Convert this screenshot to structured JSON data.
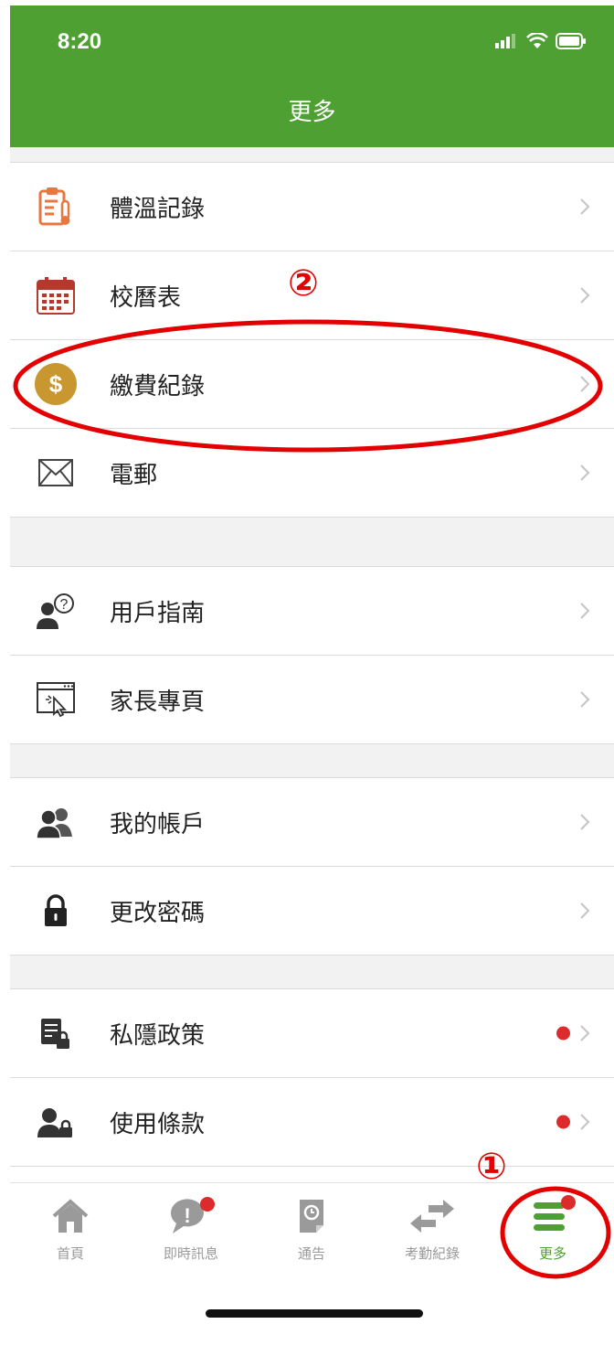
{
  "status": {
    "time": "8:20"
  },
  "header": {
    "title": "更多"
  },
  "menu": [
    {
      "label": "體溫記錄",
      "icon": "thermometer-clipboard-icon"
    },
    {
      "label": "校曆表",
      "icon": "calendar-icon"
    },
    {
      "label": "繳費紀錄",
      "icon": "dollar-coin-icon"
    },
    {
      "label": "電郵",
      "icon": "envelope-icon"
    },
    {
      "label": "用戶指南",
      "icon": "user-question-icon"
    },
    {
      "label": "家長專頁",
      "icon": "web-cursor-icon"
    },
    {
      "label": "我的帳戶",
      "icon": "users-icon"
    },
    {
      "label": "更改密碼",
      "icon": "lock-icon"
    },
    {
      "label": "私隱政策",
      "icon": "document-lock-icon"
    },
    {
      "label": "使用條款",
      "icon": "user-lock-icon"
    }
  ],
  "tabs": [
    {
      "label": "首頁",
      "icon": "home-icon"
    },
    {
      "label": "即時訊息",
      "icon": "message-icon"
    },
    {
      "label": "通告",
      "icon": "notice-icon"
    },
    {
      "label": "考勤紀錄",
      "icon": "swap-arrows-icon"
    },
    {
      "label": "更多",
      "icon": "menu-icon"
    }
  ],
  "annotations": {
    "marker_1": "①",
    "marker_2": "②"
  },
  "colors": {
    "brand_green": "#4ea032",
    "notify_red": "#dd2a2a",
    "annotation_red": "#e30000"
  }
}
